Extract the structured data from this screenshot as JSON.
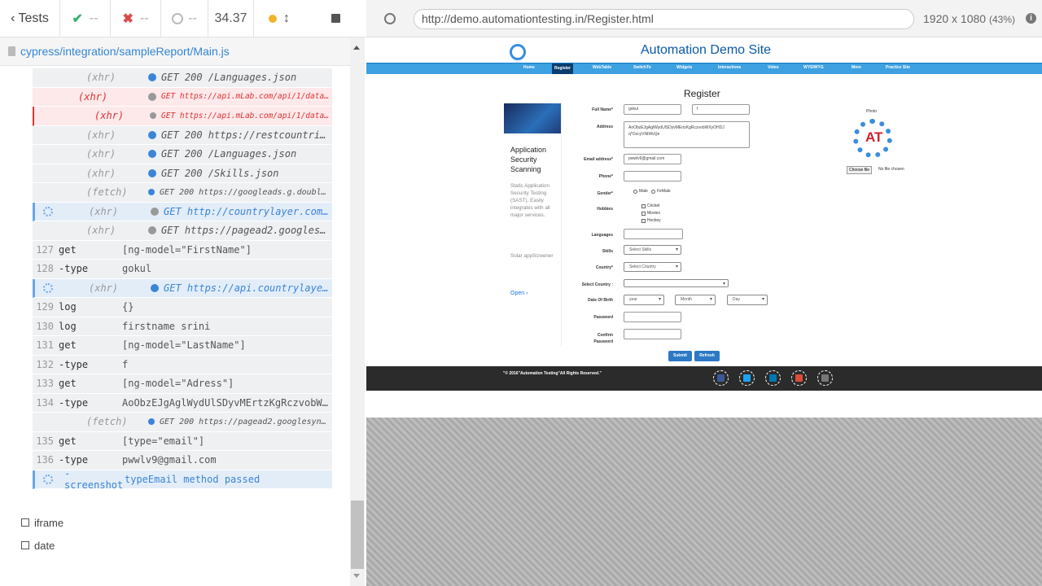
{
  "runner": {
    "tests_label": "Tests",
    "passed": "--",
    "failed": "--",
    "pending": "--",
    "duration": "34.37",
    "spec_path": "cypress/integration/sampleReport/Main.js"
  },
  "commands": [
    {
      "num": "",
      "kind": "(xhr)",
      "value": "GET 200 /Languages.json",
      "dot": "blue",
      "state": "normal"
    },
    {
      "num": "",
      "kind": "(xhr)",
      "value": "GET https://api.mLab.com/api/1/databases/...",
      "dot": "gray",
      "state": "err"
    },
    {
      "num": "",
      "kind": "(xhr)",
      "value": "GET https://api.mLab.com/api/1/databases/userd...",
      "dot": "gray",
      "state": "err-sub"
    },
    {
      "num": "",
      "kind": "(xhr)",
      "value": "GET 200 https://restcountries.eu/r...",
      "dot": "blue",
      "state": "normal"
    },
    {
      "num": "",
      "kind": "(xhr)",
      "value": "GET 200 /Languages.json",
      "dot": "blue",
      "state": "normal"
    },
    {
      "num": "",
      "kind": "(xhr)",
      "value": "GET 200 /Skills.json",
      "dot": "blue",
      "state": "normal"
    },
    {
      "num": "",
      "kind": "(fetch)",
      "value": "GET 200 https://googleads.g.doubleclick...",
      "dot": "blue",
      "state": "small"
    },
    {
      "num": "",
      "kind": "(xhr)",
      "value": "GET http://countrylayer.com/rest/v...",
      "dot": "gray",
      "state": "pending"
    },
    {
      "num": "",
      "kind": "(xhr)",
      "value": "GET https://pagead2.googlesyndicat...",
      "dot": "gray",
      "state": "normal"
    },
    {
      "num": "127",
      "kind": "get",
      "value": "[ng-model=\"FirstName\"]",
      "dot": "",
      "state": "cmd"
    },
    {
      "num": "128",
      "kind": "-type",
      "value": "gokul",
      "dot": "",
      "state": "cmd"
    },
    {
      "num": "",
      "kind": "(xhr)",
      "value": "GET https://api.countrylayer.com/r...",
      "dot": "blue",
      "state": "pending"
    },
    {
      "num": "129",
      "kind": "log",
      "value": "{}",
      "dot": "",
      "state": "cmd"
    },
    {
      "num": "130",
      "kind": "log",
      "value": "firstname srini",
      "dot": "",
      "state": "cmd"
    },
    {
      "num": "131",
      "kind": "get",
      "value": "[ng-model=\"LastName\"]",
      "dot": "",
      "state": "cmd"
    },
    {
      "num": "132",
      "kind": "-type",
      "value": "f",
      "dot": "",
      "state": "cmd"
    },
    {
      "num": "133",
      "kind": "get",
      "value": "[ng-model=\"Adress\"]",
      "dot": "",
      "state": "cmd"
    },
    {
      "num": "134",
      "kind": "-type",
      "value": "AoObzEJgAglWydUlSDyvMErtzKgRczvobWXyO...",
      "dot": "",
      "state": "cmd"
    },
    {
      "num": "",
      "kind": "(fetch)",
      "value": "GET 200 https://pagead2.googlesyndicatio...",
      "dot": "blue",
      "state": "small"
    },
    {
      "num": "135",
      "kind": "get",
      "value": "[type=\"email\"]",
      "dot": "",
      "state": "cmd"
    },
    {
      "num": "136",
      "kind": "-type",
      "value": "pwwlv9@gmail.com",
      "dot": "",
      "state": "cmd"
    },
    {
      "num": "",
      "kind": "-screenshot",
      "value": "typeEmail method passed",
      "dot": "",
      "state": "pending-cmd"
    }
  ],
  "tests": [
    "iframe",
    "date"
  ],
  "browser": {
    "url": "http://demo.automationtesting.in/Register.html",
    "size": "1920 x 1080",
    "zoom": "(43%)"
  },
  "site": {
    "title": "Automation Demo Site",
    "nav": [
      "Home",
      "Register",
      "WebTable",
      "SwitchTo",
      "Widgets",
      "Interactions",
      "Video",
      "WYSIWYG",
      "More",
      "Practice Site"
    ],
    "page_title": "Register",
    "ad": {
      "title": "Application Security Scanning",
      "desc": "Static Application Security Testing (SAST). Easily integrates with all major services.",
      "brand": "Solar appScreener",
      "open": "Open"
    },
    "form": {
      "full_name_label": "Full Name*",
      "first_name": "gokul",
      "last_name": "f",
      "address_label": "Address",
      "address": "AoObzEJgAglWydUlSDyvMErtzKgRczvobWXyOHDJ q*OzcyVNtWvQe",
      "email_label": "Email address*",
      "email": "pwwlv9@gmail.com",
      "phone_label": "Phone*",
      "gender_label": "Gender*",
      "gender_options": [
        "Male",
        "FeMale"
      ],
      "hobbies_label": "Hobbies",
      "hobbies": [
        "Cricket",
        "Movies",
        "Hockey"
      ],
      "languages_label": "Languages",
      "skills_label": "Skills",
      "skills_placeholder": "Select Skills",
      "country_label": "Country*",
      "country_placeholder": "Select Country",
      "select_country_label": "Select Country :",
      "dob_label": "Date Of Birth",
      "dob_year": "year",
      "dob_month": "Month",
      "dob_day": "Day",
      "password_label": "Password",
      "confirm_label": "Confirm Password",
      "submit": "Submit",
      "refresh": "Refresh"
    },
    "photo_label": "Photo",
    "choose_file": "Choose file",
    "no_file": "No file chosen",
    "footer": "\"© 2016\"Automation Testing\"All Rights Reserved.\""
  },
  "colors": {
    "accent": "#3386d4",
    "error": "#dd3333",
    "nav": "#3da0e0"
  }
}
